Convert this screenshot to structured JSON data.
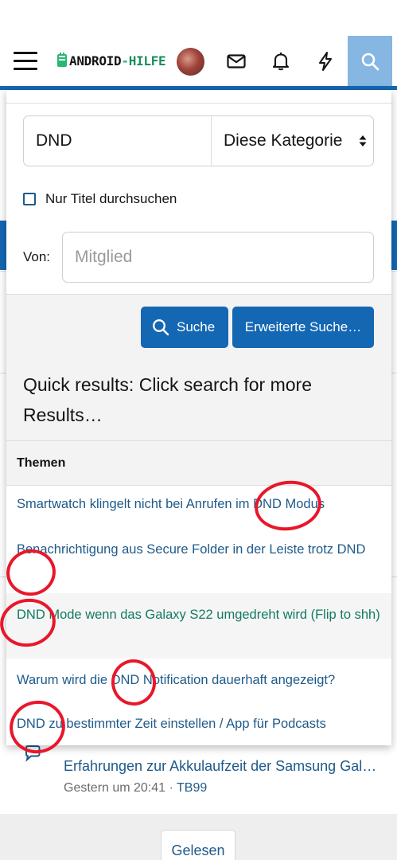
{
  "header": {
    "logo_main": "ANDROID",
    "logo_dash": "-",
    "logo_suffix": "HILFE"
  },
  "search": {
    "query": "DND",
    "scope": "Diese Kategorie",
    "title_only_label": "Nur Titel durchsuchen",
    "by_label": "Von:",
    "member_placeholder": "Mitglied",
    "submit_label": "Suche",
    "advanced_label": "Erweiterte Suche…",
    "quick_results_text": "Quick results: Click search for more Results…"
  },
  "results": {
    "section_title": "Themen",
    "items": [
      {
        "title": "Smartwatch klingelt nicht bei Anrufen im DND Modus"
      },
      {
        "title": "Benachrichtigung aus Secure Folder in der Leiste trotz DND"
      },
      {
        "title": "DND Mode wenn das Galaxy S22 umgedreht wird (Flip to shh)"
      },
      {
        "title": "Warum wird die DND Notification dauerhaft angezeigt?"
      },
      {
        "title": "DND zu bestimmter Zeit einstellen / App für Podcasts"
      }
    ]
  },
  "background": {
    "item_title": "Erfahrungen zur Akkulaufzeit der Samsung Galaxy",
    "item_time": "Gestern um 20:41 · ",
    "item_user": "TB99",
    "read_button": "Gelesen"
  },
  "colors": {
    "brand_blue": "#1467b3",
    "link_blue": "#1e5a8a",
    "visited_green": "#127a63",
    "annotation_red": "#e8172a"
  },
  "icons": [
    "menu-icon",
    "android-logo-icon",
    "mail-icon",
    "bell-icon",
    "lightning-icon",
    "search-icon",
    "select-arrows-icon",
    "chat-bubble-icon"
  ]
}
